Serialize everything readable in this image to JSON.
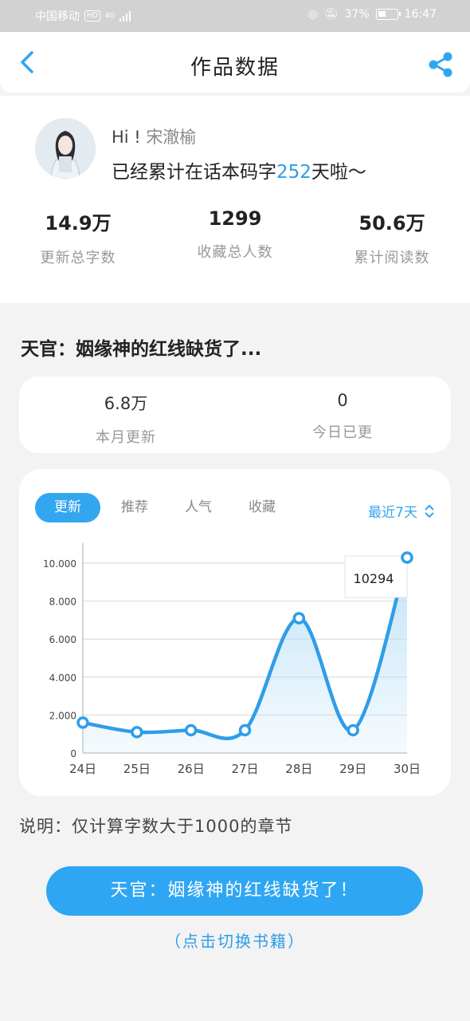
{
  "status_bar": {
    "carrier": "中国移动",
    "network_badge": "HD",
    "network_type": "4G",
    "battery": "37%",
    "time": "16:47"
  },
  "nav": {
    "title": "作品数据",
    "back_icon": "chevron-left-icon",
    "share_icon": "share-icon"
  },
  "profile": {
    "greeting": "Hi !",
    "name": "宋澈榆",
    "days_prefix": "已经累计在话本码字",
    "days_count": "252",
    "days_suffix": "天啦～",
    "stats": [
      {
        "value": "14.9万",
        "label": "更新总字数"
      },
      {
        "value": "1299",
        "label": "收藏总人数"
      },
      {
        "value": "50.6万",
        "label": "累计阅读数"
      }
    ]
  },
  "book": {
    "title": "天官：姻缘神的红线缺货了...",
    "monthly": {
      "value": "6.8万",
      "label": "本月更新"
    },
    "today": {
      "value": "0",
      "label": "今日已更"
    }
  },
  "chart_tabs": [
    "更新",
    "推荐",
    "人气",
    "收藏"
  ],
  "active_tab": "更新",
  "range_label": "最近7天",
  "colors": {
    "accent": "#2fa6f3",
    "line": "#2f9de8",
    "fill": "#bfe2f7"
  },
  "chart_data": {
    "type": "area",
    "x": [
      "24日",
      "25日",
      "26日",
      "27日",
      "28日",
      "29日",
      "30日"
    ],
    "series": [
      {
        "values": [
          1600,
          1100,
          1200,
          1200,
          7100,
          1200,
          10294
        ]
      }
    ],
    "yticks": [
      "0",
      "2.000",
      "4.000",
      "6.000",
      "8.000",
      "10.000"
    ],
    "ylim": [
      0,
      10000
    ],
    "tooltip": "10294",
    "grid": true
  },
  "note": "说明：仅计算字数大于1000的章节",
  "switch_button": "天官：姻缘神的红线缺货了！",
  "switch_hint": "（点击切换书籍）"
}
